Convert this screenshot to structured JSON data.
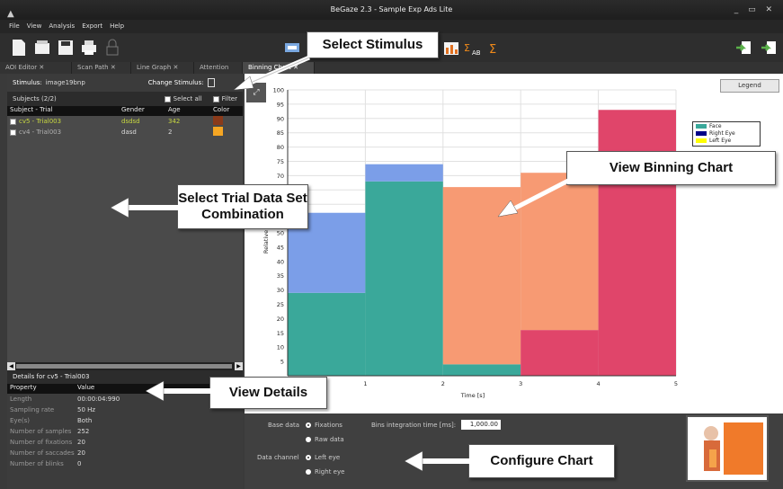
{
  "window": {
    "title": "BeGaze 2.3 - Sample Exp Ads Lite",
    "controls": "_ ▭ ✕"
  },
  "menu": [
    "File",
    "View",
    "Analysis",
    "Export",
    "Help"
  ],
  "tabs": [
    "AOI Editor",
    "Scan Path",
    "Line Graph",
    "Attention",
    "Binning Chart"
  ],
  "stimulus": {
    "label": "Stimulus:",
    "value": "image19bnp",
    "change_label": "Change Stimulus:"
  },
  "subjects": {
    "title": "Subjects (2/2)",
    "select_all": "Select all",
    "filter": "Filter",
    "columns": [
      "Subject - Trial",
      "Gender",
      "Age",
      "Color"
    ],
    "rows": [
      {
        "name": "cv5 - Trial003",
        "gender": "dsdsd",
        "age": "342",
        "color": "#8a3a1a",
        "text_color": "#c8d840"
      },
      {
        "name": "cv4 - Trial003",
        "gender": "dasd",
        "age": "2",
        "color": "#f5a623",
        "text_color": "#b0b0b0"
      }
    ]
  },
  "details": {
    "title": "Details for cv5 - Trial003",
    "columns": [
      "Property",
      "Value"
    ],
    "rows": [
      {
        "k": "Length",
        "v": "00:00:04:990"
      },
      {
        "k": "Sampling rate",
        "v": "50 Hz"
      },
      {
        "k": "Eye(s)",
        "v": "Both"
      },
      {
        "k": "Number of samples",
        "v": "252"
      },
      {
        "k": "Number of fixations",
        "v": "20"
      },
      {
        "k": "Number of saccades",
        "v": "20"
      },
      {
        "k": "Number of blinks",
        "v": "0"
      }
    ]
  },
  "chart_data": {
    "type": "bar",
    "xlabel": "Time [s]",
    "ylabel": "Relative Dwell",
    "xlim": [
      0,
      5
    ],
    "ylim": [
      0,
      100
    ],
    "xticks": [
      "1",
      "2",
      "3",
      "4",
      "5"
    ],
    "yticks": [
      "5",
      "10",
      "15",
      "20",
      "25",
      "30",
      "35",
      "40",
      "45",
      "50",
      "55",
      "60",
      "65",
      "70",
      "75",
      "80",
      "85",
      "90",
      "95",
      "100"
    ],
    "bins": [
      {
        "x0": 0,
        "x1": 1,
        "segments": [
          {
            "series": "Face",
            "value": 29
          },
          {
            "series": "Right Eye",
            "value": 28
          }
        ]
      },
      {
        "x0": 1,
        "x1": 2,
        "segments": [
          {
            "series": "Face",
            "value": 68
          },
          {
            "series": "Right Eye",
            "value": 6
          }
        ]
      },
      {
        "x0": 2,
        "x1": 3,
        "segments": [
          {
            "series": "Face",
            "value": 4
          },
          {
            "series": "Orange",
            "value": 62
          }
        ]
      },
      {
        "x0": 3,
        "x1": 4,
        "segments": [
          {
            "series": "Red",
            "value": 16
          },
          {
            "series": "Orange",
            "value": 55
          }
        ]
      },
      {
        "x0": 4,
        "x1": 5,
        "segments": [
          {
            "series": "Red",
            "value": 93
          }
        ]
      }
    ],
    "colors": {
      "Face": "#3aa89a",
      "Right Eye": "#7b9ee8",
      "Orange": "#f79a73",
      "Red": "#e0456a"
    },
    "legend_title": "Legend",
    "legend": [
      {
        "name": "Face",
        "color": "#3aa89a"
      },
      {
        "name": "Right Eye",
        "color": "#000088"
      },
      {
        "name": "Left Eye",
        "color": "#ffff00"
      }
    ]
  },
  "config": {
    "base_data_label": "Base data",
    "base_options": [
      "Fixations",
      "Raw data"
    ],
    "channel_label": "Data channel",
    "channel_options": [
      "Left eye",
      "Right eye"
    ],
    "bins_label": "Bins integration time [ms]:",
    "bins_value": "1,000.00"
  },
  "callouts": {
    "select_stimulus": "Select Stimulus",
    "select_trial": "Select Trial Data Set Combination",
    "view_binning": "View Binning Chart",
    "view_details": "View Details",
    "configure_chart": "Configure Chart"
  }
}
